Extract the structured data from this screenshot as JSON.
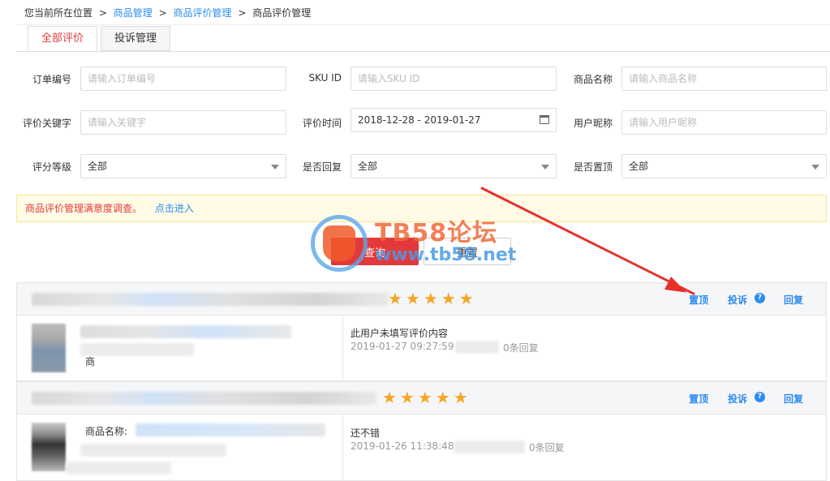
{
  "breadcrumb": {
    "prefix": "您当前所在位置",
    "sep": ">",
    "items": [
      "商品管理",
      "商品评价管理",
      "商品评价管理"
    ]
  },
  "tabs": [
    {
      "label": "全部评价",
      "active": true
    },
    {
      "label": "投诉管理",
      "active": false
    }
  ],
  "filters": {
    "order_no": {
      "label": "订单编号",
      "placeholder": "请输入订单编号"
    },
    "sku_id": {
      "label": "SKU ID",
      "placeholder": "请输入SKU ID"
    },
    "product_name": {
      "label": "商品名称",
      "placeholder": "请输入商品名称"
    },
    "keyword": {
      "label": "评价关键字",
      "placeholder": "请输入关键字"
    },
    "review_time": {
      "label": "评价时间",
      "value": "2018-12-28 - 2019-01-27"
    },
    "nickname": {
      "label": "用户昵称",
      "placeholder": "请输入用户昵称"
    },
    "rating": {
      "label": "评分等级",
      "value": "全部"
    },
    "replied": {
      "label": "是否回复",
      "value": "全部"
    },
    "pinned": {
      "label": "是否置顶",
      "value": "全部"
    }
  },
  "notice": {
    "text": "商品评价管理满意度调查。",
    "link": "点击进入"
  },
  "buttons": {
    "query": "查询",
    "reset": "重置"
  },
  "watermark": {
    "title": "TB58论坛",
    "url": "www.tb58.net"
  },
  "reviews": [
    {
      "stars": "★★★★★",
      "actions": {
        "pin": "置顶",
        "complain": "投诉",
        "reply": "回复",
        "help": "?"
      },
      "product_label": "商",
      "comment": "此用户未填写评价内容",
      "time": "2019-01-27 09:27:59",
      "reply_count": "0条回复"
    },
    {
      "stars": "★★★★★",
      "actions": {
        "pin": "置顶",
        "complain": "投诉",
        "reply": "回复",
        "help": "?"
      },
      "product_label": "商品名称:",
      "comment": "还不错",
      "time": "2019-01-26 11:38:48",
      "reply_count": "0条回复"
    }
  ],
  "colors": {
    "accent": "#e4393c",
    "link": "#2d8cf0",
    "star": "#f5a623"
  }
}
